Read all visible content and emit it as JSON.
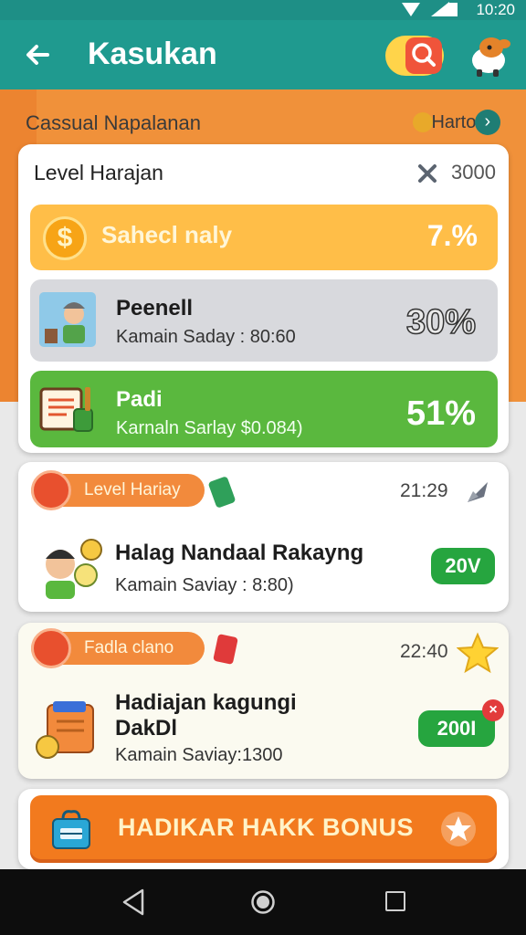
{
  "status_bar": {
    "time": "10:20"
  },
  "app_bar": {
    "title": "Kasukan"
  },
  "header": {
    "subtitle": "Cassual Napalanan",
    "link_label": "Harto"
  },
  "level_card": {
    "title": "Level Harajan",
    "count": "3000",
    "rows": [
      {
        "label": "Sahecl naly",
        "value": "7.%",
        "color": "#ffbe48"
      },
      {
        "title": "Peenell",
        "subtitle": "Kamain Saday : 80:60",
        "value": "30%",
        "color": "#d8d9dd"
      },
      {
        "title": "Padi",
        "subtitle": "Karnaln Sarlay  $0.084)",
        "value": "51%",
        "color": "#5ab83e"
      }
    ]
  },
  "task_cards": [
    {
      "badge_label": "Level Hariay",
      "time": "21:29",
      "title": "Halag Nandaal Rakayng",
      "subtitle": "Kamain Saviay : 8:80)",
      "button_label": "20V",
      "action_icon": "rocket-icon"
    },
    {
      "badge_label": "Fadla clano",
      "time": "22:40",
      "title": "Hadiajan kagungi DakDl",
      "subtitle": "Kamain Saviay:1300",
      "button_label": "200I",
      "action_icon": "star-icon"
    }
  ],
  "bonus": {
    "label": "HADIKAR HAKK BONUS"
  },
  "colors": {
    "teal": "#1f9a8f",
    "orange": "#f0913a",
    "green": "#26a53f",
    "accent_red": "#e8502e"
  }
}
